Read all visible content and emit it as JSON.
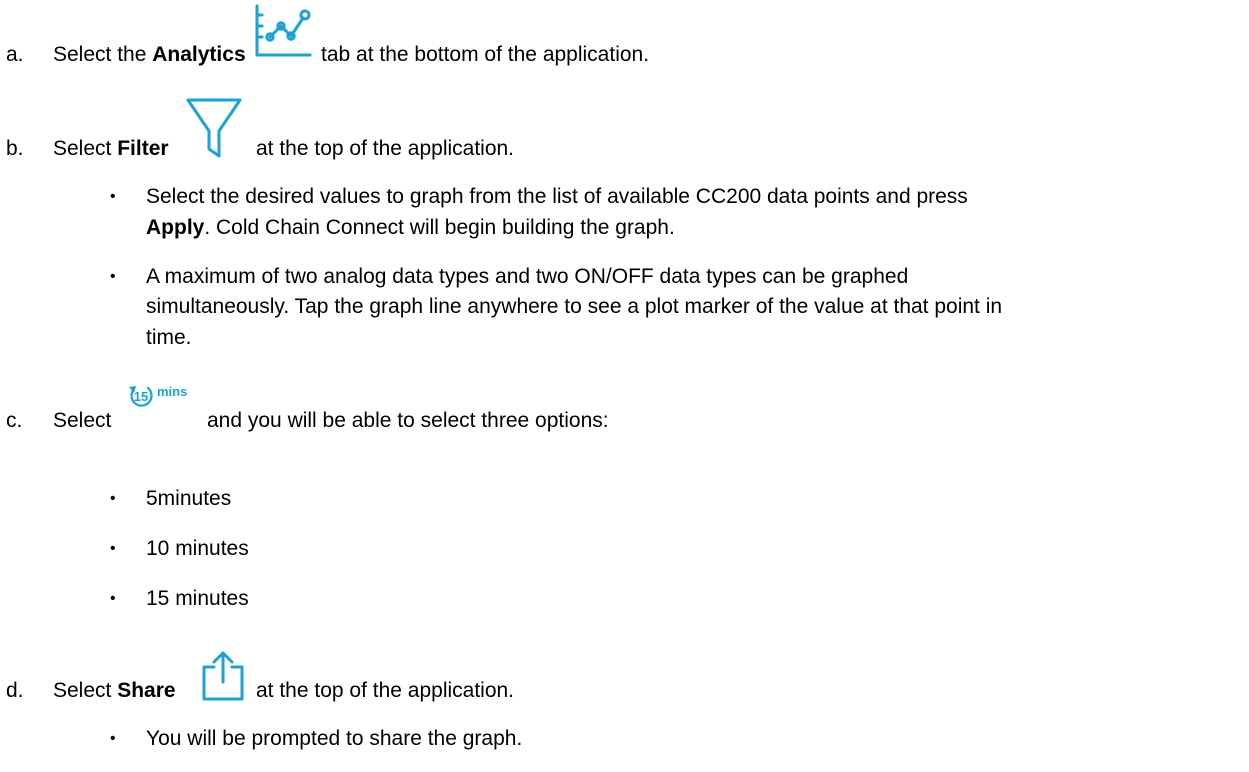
{
  "steps": [
    {
      "letter": "a.",
      "pre": "Select the",
      "bold": "Analytics",
      "icon": "analytics-icon",
      "post": "tab at the bottom of the application."
    },
    {
      "letter": "b.",
      "pre": "Select",
      "bold": "Filter",
      "icon": "filter-icon",
      "post": "at the top of the application.",
      "bullets": [
        {
          "line1": "Select the desired values to graph from the list of available CC200 data points and press",
          "line2_bold": "Apply",
          "line2_rest": ". Cold Chain Connect will begin building the graph."
        },
        {
          "line1": "A maximum of two analog data types and two ON/OFF data types can be graphed",
          "line2": "simultaneously. Tap the graph line anywhere to see a plot marker of the value at that point in",
          "line3": "time."
        }
      ]
    },
    {
      "letter": "c.",
      "pre": "Select",
      "icon": "interval-15-mins-icon",
      "icon_number": "15",
      "icon_unit": "mins",
      "post": "and you will be able to select three options:",
      "options": [
        "5minutes",
        "10 minutes",
        "15 minutes"
      ]
    },
    {
      "letter": "d.",
      "pre": "Select",
      "bold": "Share",
      "icon": "share-icon",
      "post": "at the top of the application.",
      "bullets": [
        "You will be prompted to share the graph."
      ]
    }
  ],
  "colors": {
    "icon_blue": "#1aa3d9"
  }
}
